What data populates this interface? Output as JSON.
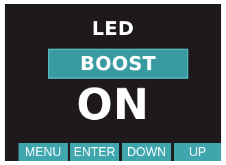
{
  "screen": {
    "title": "LED",
    "mode": "BOOST",
    "value": "ON"
  },
  "buttons": {
    "menu": "MENU",
    "enter": "ENTER",
    "down": "DOWN",
    "up": "UP"
  },
  "colors": {
    "screen_background": "#1e1a1b",
    "accent": "#3a9aa2",
    "button": "#3fa6ad",
    "text": "#ffffff"
  }
}
